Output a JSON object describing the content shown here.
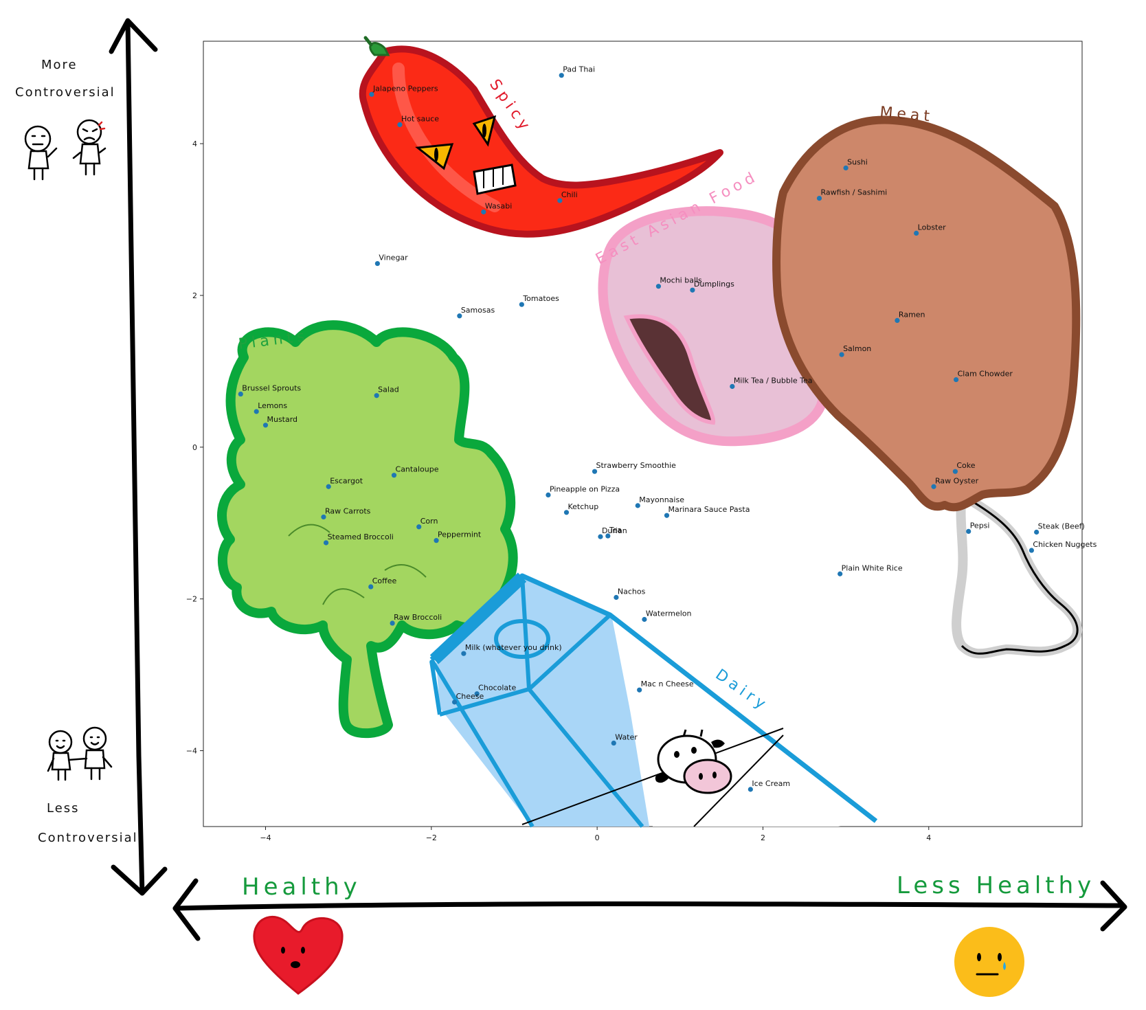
{
  "chart_data": {
    "type": "scatter",
    "title": "",
    "xlabel": "",
    "ylabel": "",
    "xlim": [
      -4.75,
      5.85
    ],
    "ylim": [
      -5.0,
      5.35
    ],
    "xticks": [
      -4,
      -2,
      0,
      2,
      4
    ],
    "yticks": [
      -4,
      -2,
      0,
      2,
      4
    ],
    "tick_labels_x": [
      "−4",
      "−2",
      "0",
      "2",
      "4"
    ],
    "tick_labels_y": [
      "−4",
      "−2",
      "0",
      "2",
      "4"
    ],
    "grid": false,
    "point_color": "#1f77b4",
    "points": [
      {
        "label": "Pad Thai",
        "x": -0.43,
        "y": 4.9
      },
      {
        "label": "Jalapeno Peppers",
        "x": -2.72,
        "y": 4.65
      },
      {
        "label": "Hot sauce",
        "x": -2.38,
        "y": 4.25
      },
      {
        "label": "Chili",
        "x": -0.45,
        "y": 3.25
      },
      {
        "label": "Wasabi",
        "x": -1.37,
        "y": 3.1
      },
      {
        "label": "Sushi",
        "x": 3.0,
        "y": 3.68
      },
      {
        "label": "Rawfish / Sashimi",
        "x": 2.68,
        "y": 3.28
      },
      {
        "label": "Lobster",
        "x": 3.85,
        "y": 2.82
      },
      {
        "label": "Vinegar",
        "x": -2.65,
        "y": 2.42
      },
      {
        "label": "Mochi balls",
        "x": 0.74,
        "y": 2.12
      },
      {
        "label": "Dumplings",
        "x": 1.15,
        "y": 2.07
      },
      {
        "label": "Tomatoes",
        "x": -0.91,
        "y": 1.88
      },
      {
        "label": "Samosas",
        "x": -1.66,
        "y": 1.73
      },
      {
        "label": "Ramen",
        "x": 3.62,
        "y": 1.67
      },
      {
        "label": "Salmon",
        "x": 2.95,
        "y": 1.22
      },
      {
        "label": "Clam Chowder",
        "x": 4.33,
        "y": 0.89
      },
      {
        "label": "Milk Tea / Bubble Tea",
        "x": 1.63,
        "y": 0.8
      },
      {
        "label": "Brussel Sprouts",
        "x": -4.3,
        "y": 0.7
      },
      {
        "label": "Salad",
        "x": -2.66,
        "y": 0.68
      },
      {
        "label": "Lemons",
        "x": -4.11,
        "y": 0.47
      },
      {
        "label": "Mustard",
        "x": -4.0,
        "y": 0.29
      },
      {
        "label": "Strawberry Smoothie",
        "x": -0.03,
        "y": -0.32
      },
      {
        "label": "Cantaloupe",
        "x": -2.45,
        "y": -0.37
      },
      {
        "label": "Coke",
        "x": 4.32,
        "y": -0.32
      },
      {
        "label": "Escargot",
        "x": -3.24,
        "y": -0.52
      },
      {
        "label": "Raw Oyster",
        "x": 4.06,
        "y": -0.52
      },
      {
        "label": "Pineapple on Pizza",
        "x": -0.59,
        "y": -0.63
      },
      {
        "label": "Mayonnaise",
        "x": 0.49,
        "y": -0.77
      },
      {
        "label": "Ketchup",
        "x": -0.37,
        "y": -0.86
      },
      {
        "label": "Marinara Sauce Pasta",
        "x": 0.84,
        "y": -0.9
      },
      {
        "label": "Raw Carrots",
        "x": -3.3,
        "y": -0.92
      },
      {
        "label": "Corn",
        "x": -2.15,
        "y": -1.05
      },
      {
        "label": "Pepsi",
        "x": 4.48,
        "y": -1.11
      },
      {
        "label": "Steak (Beef)",
        "x": 5.3,
        "y": -1.12
      },
      {
        "label": "Durian",
        "x": 0.04,
        "y": -1.18
      },
      {
        "label": "Tea",
        "x": 0.13,
        "y": -1.17
      },
      {
        "label": "Peppermint",
        "x": -1.94,
        "y": -1.23
      },
      {
        "label": "Steamed Broccoli",
        "x": -3.27,
        "y": -1.26
      },
      {
        "label": "Chicken Nuggets",
        "x": 5.24,
        "y": -1.36
      },
      {
        "label": "Plain White Rice",
        "x": 2.93,
        "y": -1.67
      },
      {
        "label": "Coffee",
        "x": -2.73,
        "y": -1.84
      },
      {
        "label": "Nachos",
        "x": 0.23,
        "y": -1.98
      },
      {
        "label": "Watermelon",
        "x": 0.57,
        "y": -2.27
      },
      {
        "label": "Raw Broccoli",
        "x": -2.47,
        "y": -2.32
      },
      {
        "label": "Milk (whatever you drink)",
        "x": -1.61,
        "y": -2.72
      },
      {
        "label": "Mac n Cheese",
        "x": 0.51,
        "y": -3.2
      },
      {
        "label": "Chocolate",
        "x": -1.45,
        "y": -3.25
      },
      {
        "label": "Cheese",
        "x": -1.72,
        "y": -3.36
      },
      {
        "label": "Water",
        "x": 0.2,
        "y": -3.9
      },
      {
        "label": "Ice Cream",
        "x": 1.85,
        "y": -4.51
      }
    ]
  },
  "annotations": {
    "y_axis_top": [
      "More",
      "Controversial"
    ],
    "y_axis_bottom": [
      "Less",
      "Controversial"
    ],
    "x_axis_left": "Healthy",
    "x_axis_right": "Less Healthy",
    "categories": {
      "spicy": "Spicy",
      "meat": "Meat",
      "east_asian": "East Asian Food",
      "plants": "Plants",
      "dairy": "Dairy"
    }
  }
}
